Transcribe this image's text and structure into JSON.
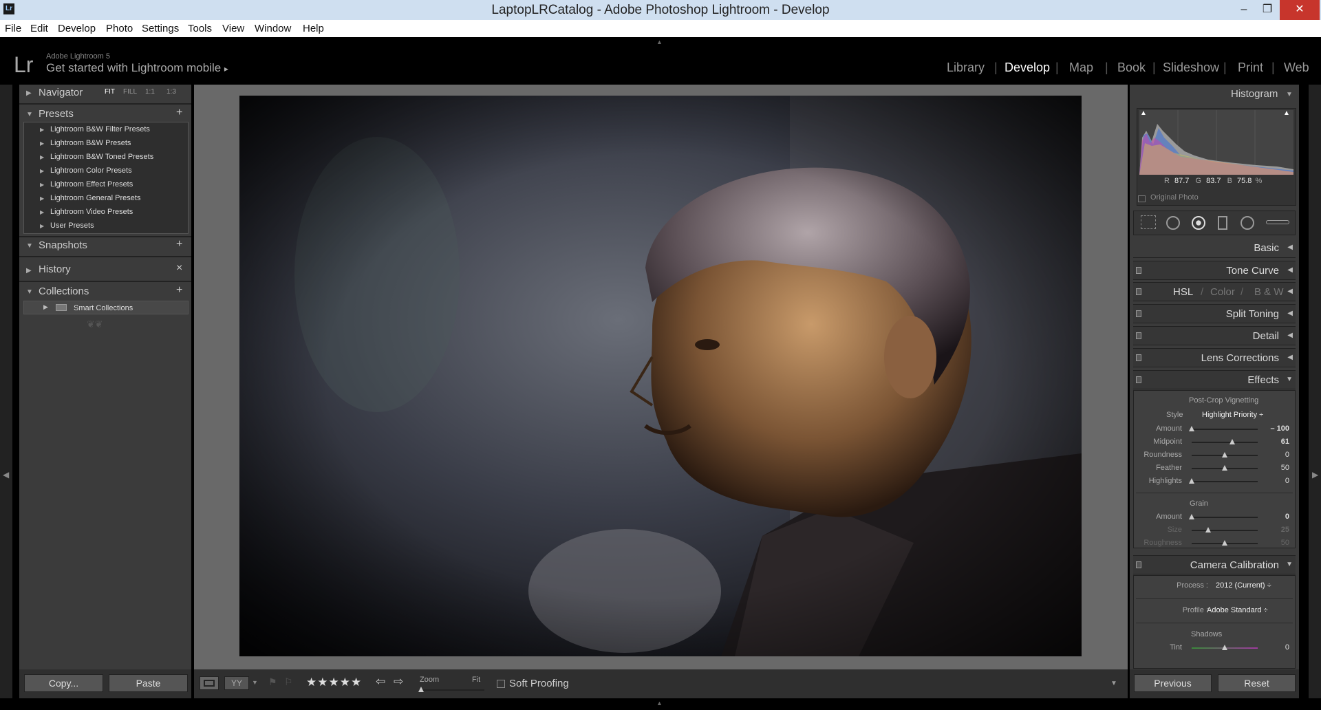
{
  "window": {
    "title": "LaptopLRCatalog - Adobe Photoshop Lightroom - Develop",
    "icon": "Lr",
    "minimize": "–",
    "maximize": "❐",
    "close": "✕"
  },
  "menu": [
    "File",
    "Edit",
    "Develop",
    "Photo",
    "Settings",
    "Tools",
    "View",
    "Window",
    "Help"
  ],
  "identity": {
    "logo": "Lr",
    "product": "Adobe Lightroom 5",
    "mobile": "Get started with Lightroom mobile",
    "mobile_arrow": "▸"
  },
  "modules": [
    {
      "label": "Library"
    },
    {
      "label": "Develop"
    },
    {
      "label": "Map"
    },
    {
      "label": "Book"
    },
    {
      "label": "Slideshow"
    },
    {
      "label": "Print"
    },
    {
      "label": "Web"
    }
  ],
  "navigator": {
    "title": "Navigator",
    "options": [
      "FIT",
      "FILL",
      "1:1",
      "1:3"
    ]
  },
  "presets": {
    "title": "Presets",
    "items": [
      "Lightroom B&W Filter Presets",
      "Lightroom B&W Presets",
      "Lightroom B&W Toned Presets",
      "Lightroom Color Presets",
      "Lightroom Effect Presets",
      "Lightroom General Presets",
      "Lightroom Video Presets",
      "User Presets"
    ]
  },
  "snapshots": {
    "title": "Snapshots"
  },
  "history": {
    "title": "History",
    "x": "×"
  },
  "collections": {
    "title": "Collections",
    "items": [
      "Smart Collections"
    ]
  },
  "left_buttons": {
    "copy": "Copy...",
    "paste": "Paste"
  },
  "toolbar": {
    "zoom_label": "Zoom",
    "zoom_value": "Fit",
    "soft_proofing": "Soft Proofing",
    "stars": "★★★★★",
    "view_compare": "YY"
  },
  "histogram": {
    "title": "Histogram",
    "r_label": "R",
    "r": "87.7",
    "g_label": "G",
    "g": "83.7",
    "b_label": "B",
    "b": "75.8",
    "unit": "%",
    "original": "Original Photo"
  },
  "panels": [
    "Basic",
    "Tone Curve",
    "Split Toning",
    "Detail",
    "Lens Corrections",
    "Effects",
    "Camera Calibration"
  ],
  "hsl": {
    "a": "HSL",
    "b": "Color",
    "c": "B & W",
    "slash": "/"
  },
  "effects": {
    "vignette_title": "Post-Crop Vignetting",
    "style_label": "Style",
    "style_value": "Highlight Priority ÷",
    "sliders": [
      {
        "label": "Amount",
        "value": "– 100",
        "pos": 0
      },
      {
        "label": "Midpoint",
        "value": "61",
        "pos": 0.61
      },
      {
        "label": "Roundness",
        "value": "0",
        "pos": 0.5
      },
      {
        "label": "Feather",
        "value": "50",
        "pos": 0.5
      },
      {
        "label": "Highlights",
        "value": "0",
        "pos": 0
      }
    ],
    "grain_title": "Grain",
    "grain": [
      {
        "label": "Amount",
        "value": "0",
        "pos": 0
      },
      {
        "label": "Size",
        "value": "25",
        "pos": 0.25
      },
      {
        "label": "Roughness",
        "value": "50",
        "pos": 0.5
      }
    ]
  },
  "calibration": {
    "process_label": "Process :",
    "process_value": "2012 (Current) ÷",
    "profile_label": "Profile :",
    "profile_value": "Adobe Standard ÷",
    "shadows": "Shadows",
    "tint_label": "Tint",
    "tint_value": "0",
    "tint_pos": 0.5
  },
  "right_buttons": {
    "previous": "Previous",
    "reset": "Reset"
  }
}
